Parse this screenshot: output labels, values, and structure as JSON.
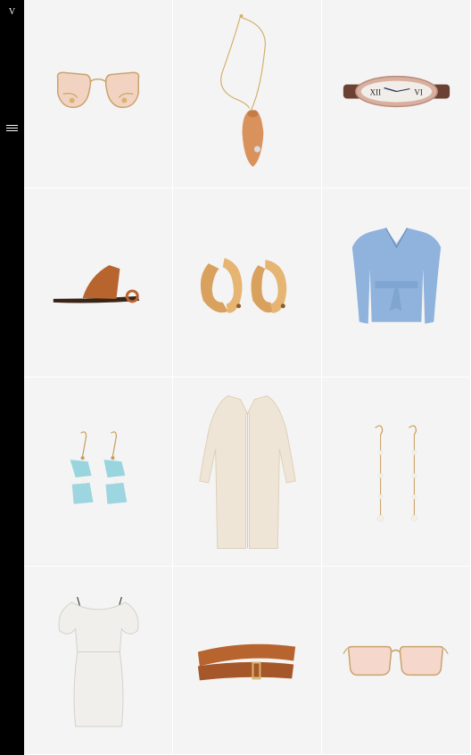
{
  "brand": {
    "logo_text": "V"
  },
  "menu": {
    "icon": "hamburger-icon"
  },
  "products": [
    {
      "name": "sunglasses-butterfly",
      "icon": "sunglasses-icon"
    },
    {
      "name": "pendant-necklace",
      "icon": "necklace-icon"
    },
    {
      "name": "oval-watch",
      "icon": "watch-icon"
    },
    {
      "name": "leather-slide-sandal",
      "icon": "sandal-icon"
    },
    {
      "name": "hoop-earrings",
      "icon": "hoop-earrings-icon"
    },
    {
      "name": "puff-sleeve-blouse",
      "icon": "blouse-icon"
    },
    {
      "name": "crystal-drop-earrings",
      "icon": "drop-earrings-icon"
    },
    {
      "name": "long-cardigan",
      "icon": "cardigan-icon"
    },
    {
      "name": "pearl-drop-earrings",
      "icon": "pearl-earrings-icon"
    },
    {
      "name": "off-shoulder-dress",
      "icon": "dress-icon"
    },
    {
      "name": "leather-wrap-belt",
      "icon": "belt-icon"
    },
    {
      "name": "square-sunglasses",
      "icon": "sunglasses-icon"
    }
  ]
}
